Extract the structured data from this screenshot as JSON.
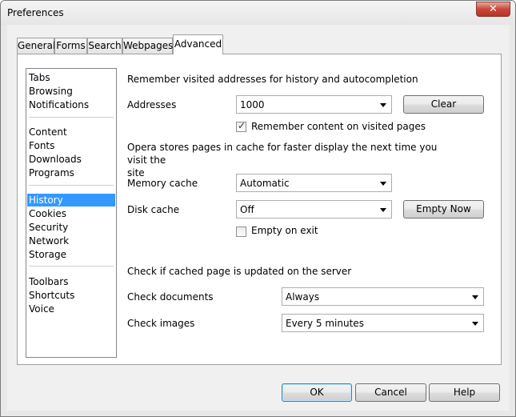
{
  "window": {
    "title": "Preferences",
    "close_glyph": "✕"
  },
  "tabs": [
    {
      "label": "General"
    },
    {
      "label": "Forms"
    },
    {
      "label": "Search"
    },
    {
      "label": "Webpages"
    },
    {
      "label": "Advanced"
    }
  ],
  "sidebar": {
    "items": [
      "Tabs",
      "Browsing",
      "Notifications",
      "Content",
      "Fonts",
      "Downloads",
      "Programs",
      "History",
      "Cookies",
      "Security",
      "Network",
      "Storage",
      "Toolbars",
      "Shortcuts",
      "Voice"
    ],
    "selected": "History"
  },
  "history": {
    "remember_heading": "Remember visited addresses for history and autocompletion",
    "addresses_label": "Addresses",
    "addresses_value": "1000",
    "clear_button": "Clear",
    "remember_content_label": "Remember content on visited pages",
    "remember_content_checked": true,
    "cache_heading": "Opera stores pages in cache for faster display the next time you visit the site",
    "cache_heading_line1": "Opera stores pages in cache for faster display the next time you visit the",
    "cache_heading_line2": "site",
    "memory_cache_label": "Memory cache",
    "memory_cache_value": "Automatic",
    "disk_cache_label": "Disk cache",
    "disk_cache_value": "Off",
    "empty_now_button": "Empty Now",
    "empty_on_exit_label": "Empty on exit",
    "empty_on_exit_checked": false,
    "check_heading": "Check if cached page is updated on the server",
    "check_documents_label": "Check documents",
    "check_documents_value": "Always",
    "check_images_label": "Check images",
    "check_images_value": "Every 5 minutes"
  },
  "footer": {
    "ok": "OK",
    "cancel": "Cancel",
    "help": "Help"
  },
  "colors": {
    "selection": "#3399ff",
    "close_button": "#c8463a"
  }
}
